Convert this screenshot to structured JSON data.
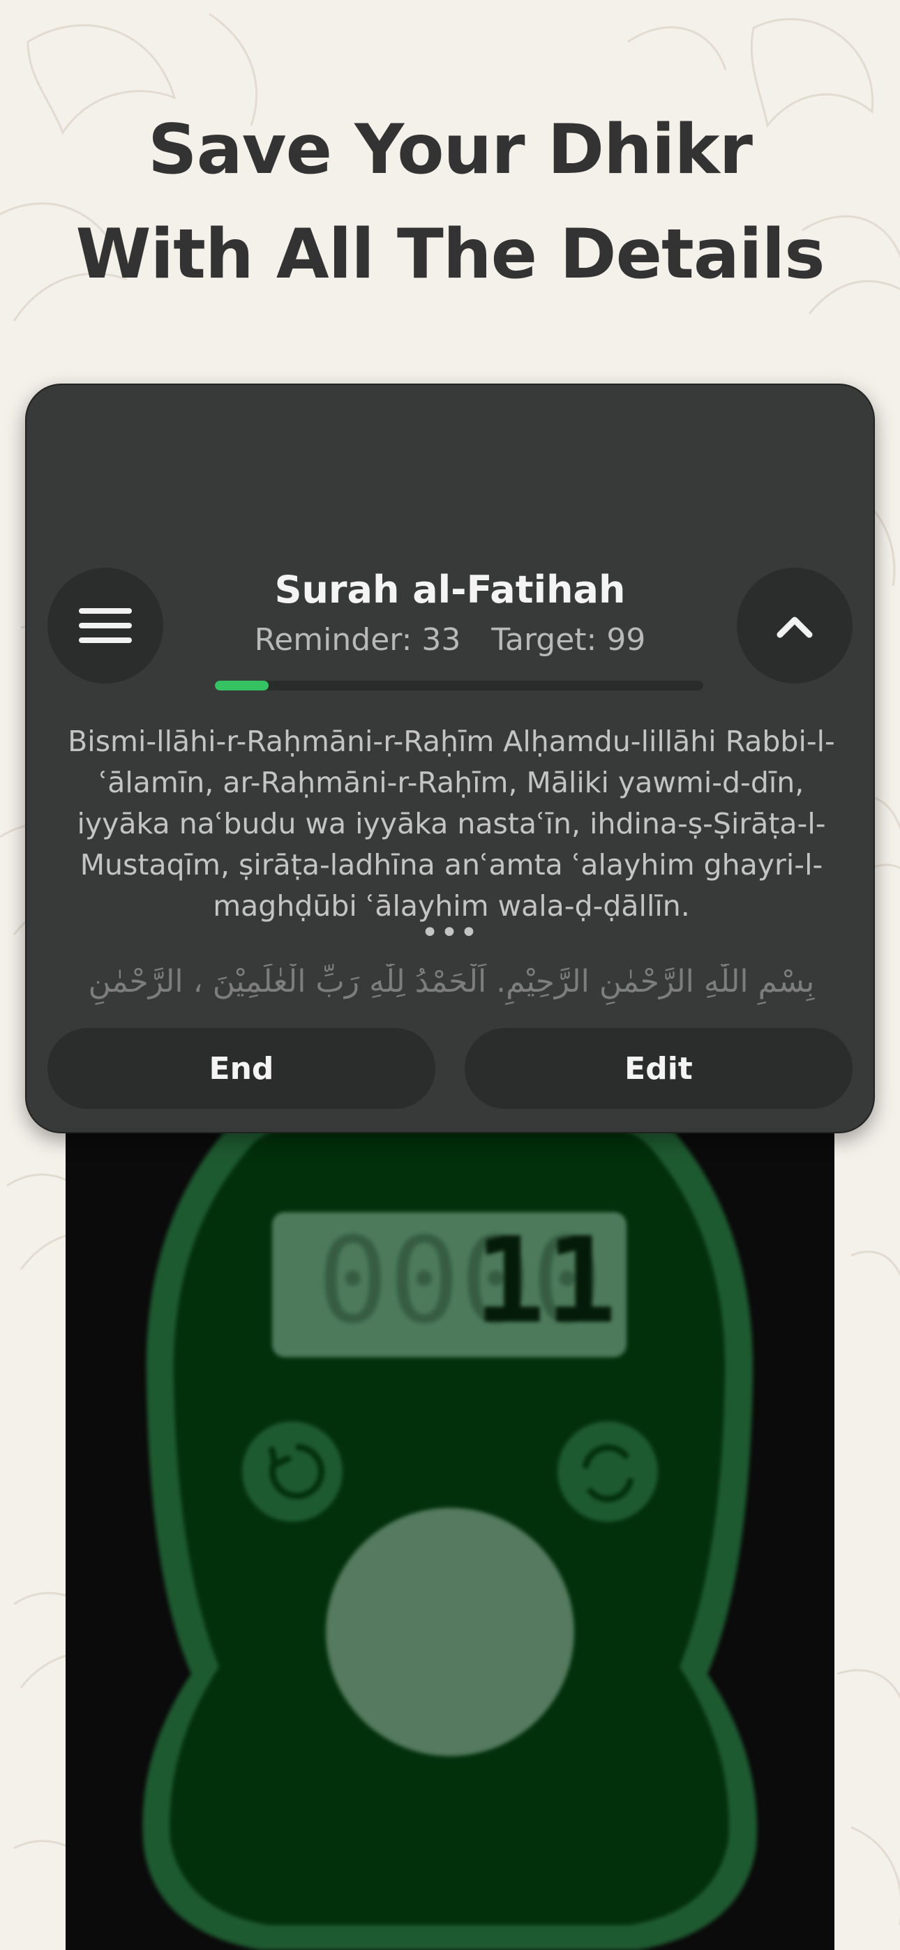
{
  "headline": {
    "line1": "Save Your Dhikr",
    "line2": "With All The Details"
  },
  "card": {
    "title": "Surah al-Fatihah",
    "reminder": "Reminder: 33",
    "target": "Target: 99",
    "progress_fraction": 0.11,
    "transliteration": "Bismi-llāhi-r-Raḥmāni-r-Raḥīm Alḥamdu-lillāhi Rabbi-l-ʿālamīn, ar-Raḥmāni-r-Raḥīm, Māliki yawmi-d-dīn, iyyāka naʿbudu wa iyyāka nastaʿīn, ihdina-ṣ-Ṣirāṭa-l-Mustaqīm, ṣirāṭa-ladhīna anʿamta ʿalayhim ghayri-l-maghḍūbi ʿālayhim wala-ḍ-ḍāllīn.",
    "ellipsis": "•••",
    "arabic": "بِسْمِ اللّٰهِ الرَّحْمٰنِ الرَّحِيْمِ. اَلْحَمْدُ لِلّٰهِ رَبِّ الْعٰلَمِيْنَ ، الرَّحْمٰنِ",
    "end_label": "End",
    "edit_label": "Edit",
    "menu_icon": "menu-icon",
    "collapse_icon": "chevron-up-icon"
  },
  "counter": {
    "display_value": "11",
    "colors": {
      "body": "#1e5a30",
      "inner": "#02300b",
      "accent": "#34c262"
    }
  },
  "colors": {
    "background": "#f4f0ea",
    "card": "#383a39",
    "button": "#2b2d2c",
    "progress": "#34c262"
  }
}
